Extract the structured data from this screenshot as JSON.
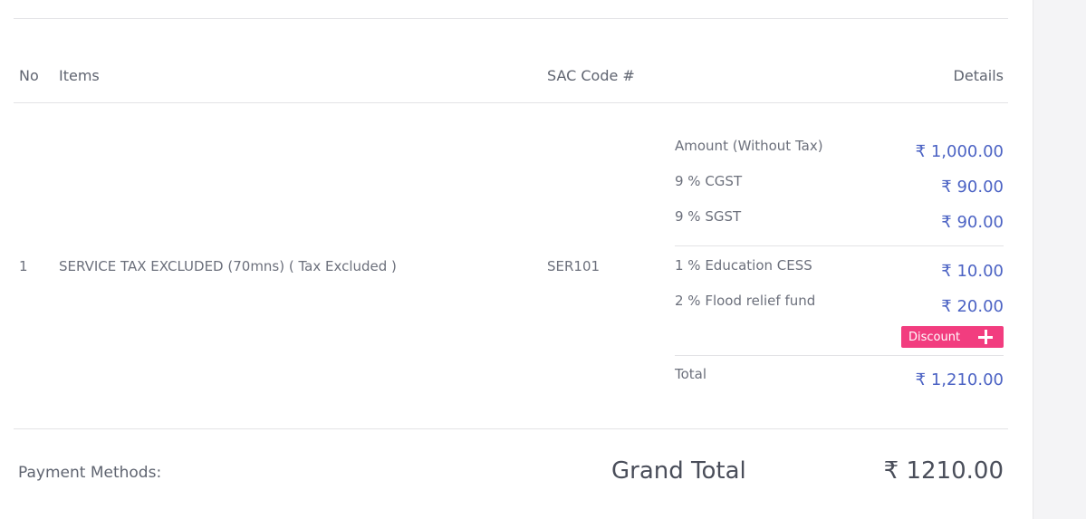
{
  "table": {
    "headers": {
      "no": "No",
      "items": "Items",
      "sac": "SAC Code #",
      "details": "Details"
    },
    "row": {
      "no": "1",
      "item": "SERVICE TAX EXCLUDED (70mns) ( Tax Excluded )",
      "sac": "SER101",
      "details": [
        {
          "label": "Amount (Without Tax)",
          "value": "₹ 1,000.00"
        },
        {
          "label": "9 % CGST",
          "value": "₹ 90.00"
        },
        {
          "label": "9 % SGST",
          "value": "₹ 90.00"
        },
        {
          "label": "1 % Education CESS",
          "value": "₹ 10.00"
        },
        {
          "label": "2 % Flood relief fund",
          "value": "₹ 20.00"
        }
      ],
      "discount_label": "Discount",
      "total_label": "Total",
      "total_value": "₹ 1,210.00"
    }
  },
  "footer": {
    "payment_methods_label": "Payment Methods:",
    "grand_total_label": "Grand Total",
    "grand_total_value": "₹ 1210.00"
  },
  "colors": {
    "accent": "#4c63c4",
    "discount": "#f23d7f"
  }
}
